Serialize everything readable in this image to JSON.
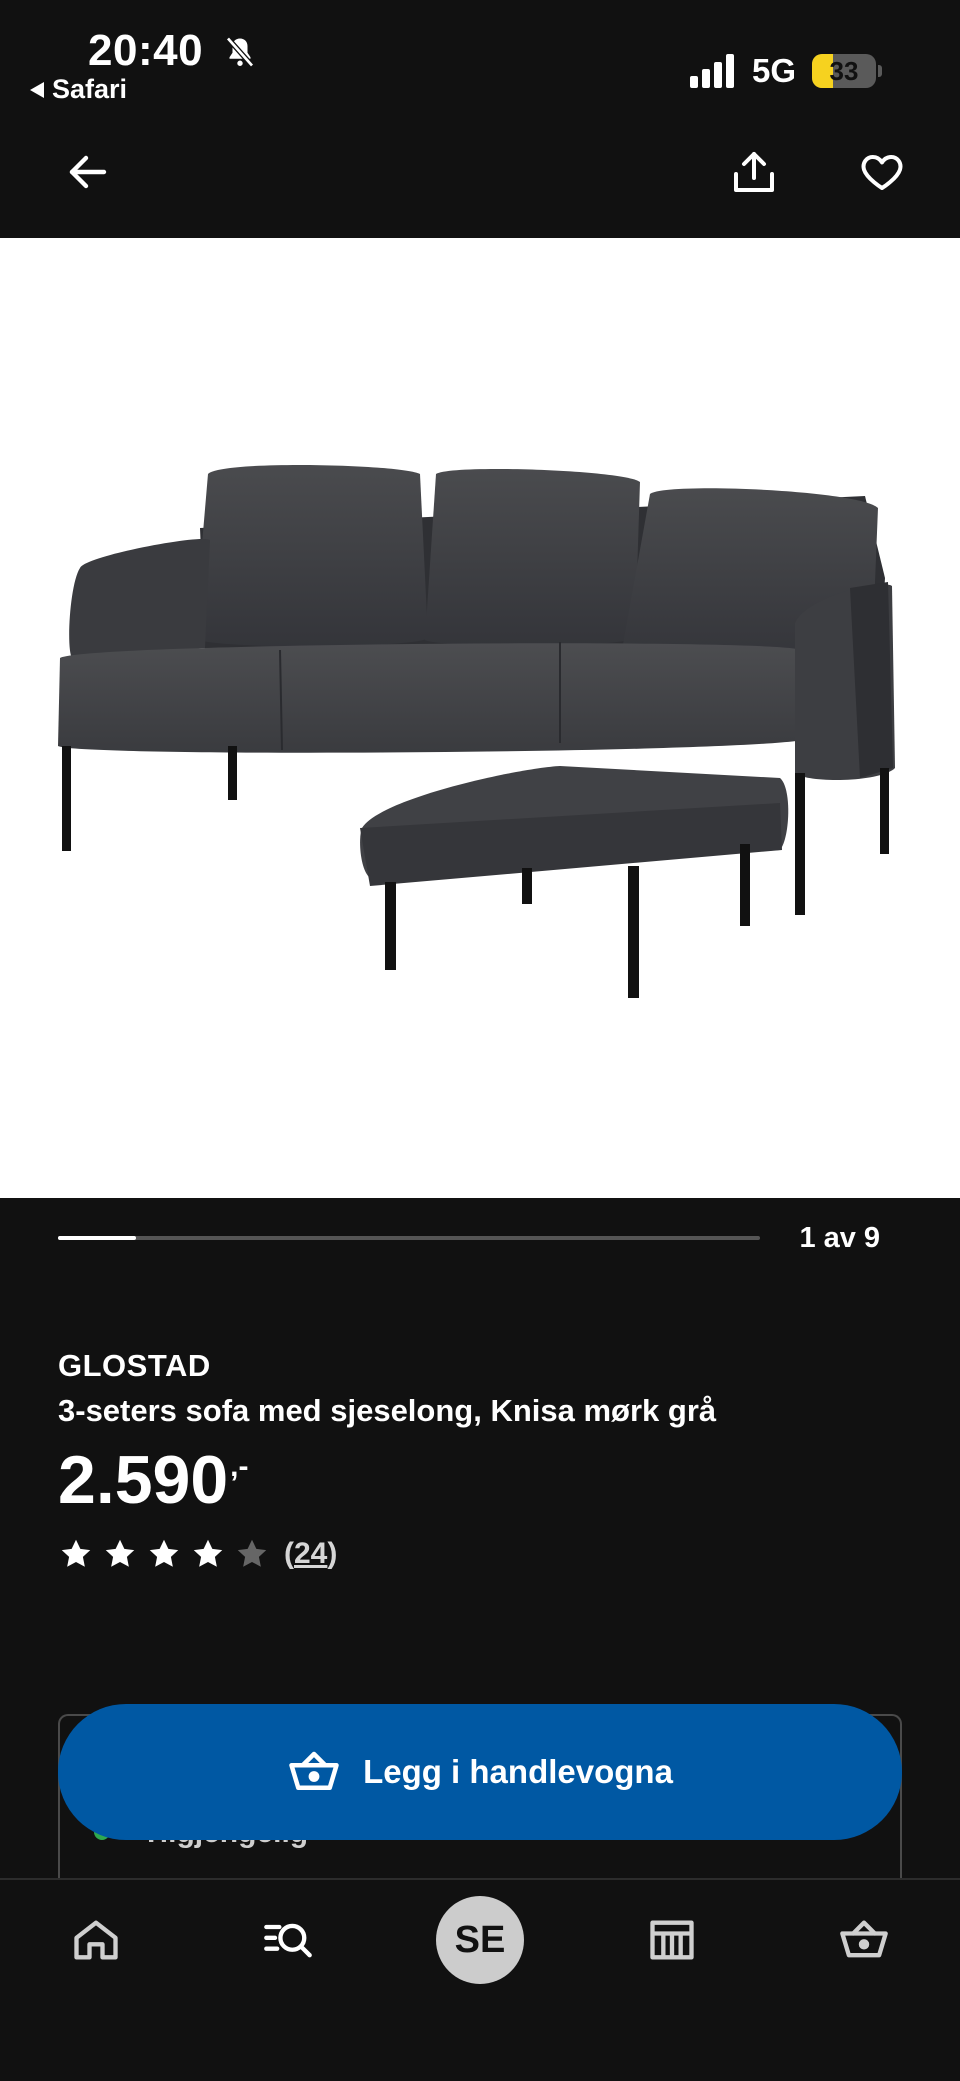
{
  "status_bar": {
    "time": "20:40",
    "back_app": "Safari",
    "network": "5G",
    "battery": "33",
    "battery_level_percent": 33,
    "icons": [
      "bell-slash-icon",
      "signal-icon"
    ]
  },
  "top_nav": {
    "icons": [
      "arrow-left-icon",
      "share-icon",
      "heart-icon"
    ]
  },
  "gallery": {
    "current": "1",
    "separator": "av",
    "total": "9",
    "progress_fraction": 0.111
  },
  "product": {
    "name": "GLOSTAD",
    "description": "3-seters sofa med sjeselong, Knisa mørk grå",
    "price": "2.590",
    "price_suffix": ",-",
    "rating_value": 4,
    "rating_max": 5,
    "rating_open": "(",
    "rating_count": "24",
    "rating_close": ")"
  },
  "availability": {
    "text": "Tilgjengelig"
  },
  "cart_button": {
    "label": "Legg i handlevogna"
  },
  "bottom_nav": {
    "store_badge": "SE",
    "icons": [
      "home-icon",
      "search-list-icon",
      "store-icon",
      "basket-icon"
    ]
  },
  "colors": {
    "background": "#111111",
    "primary_button": "#0058a3",
    "battery": "#f6d21f",
    "star_filled": "#ffffff",
    "star_empty": "#666666"
  }
}
